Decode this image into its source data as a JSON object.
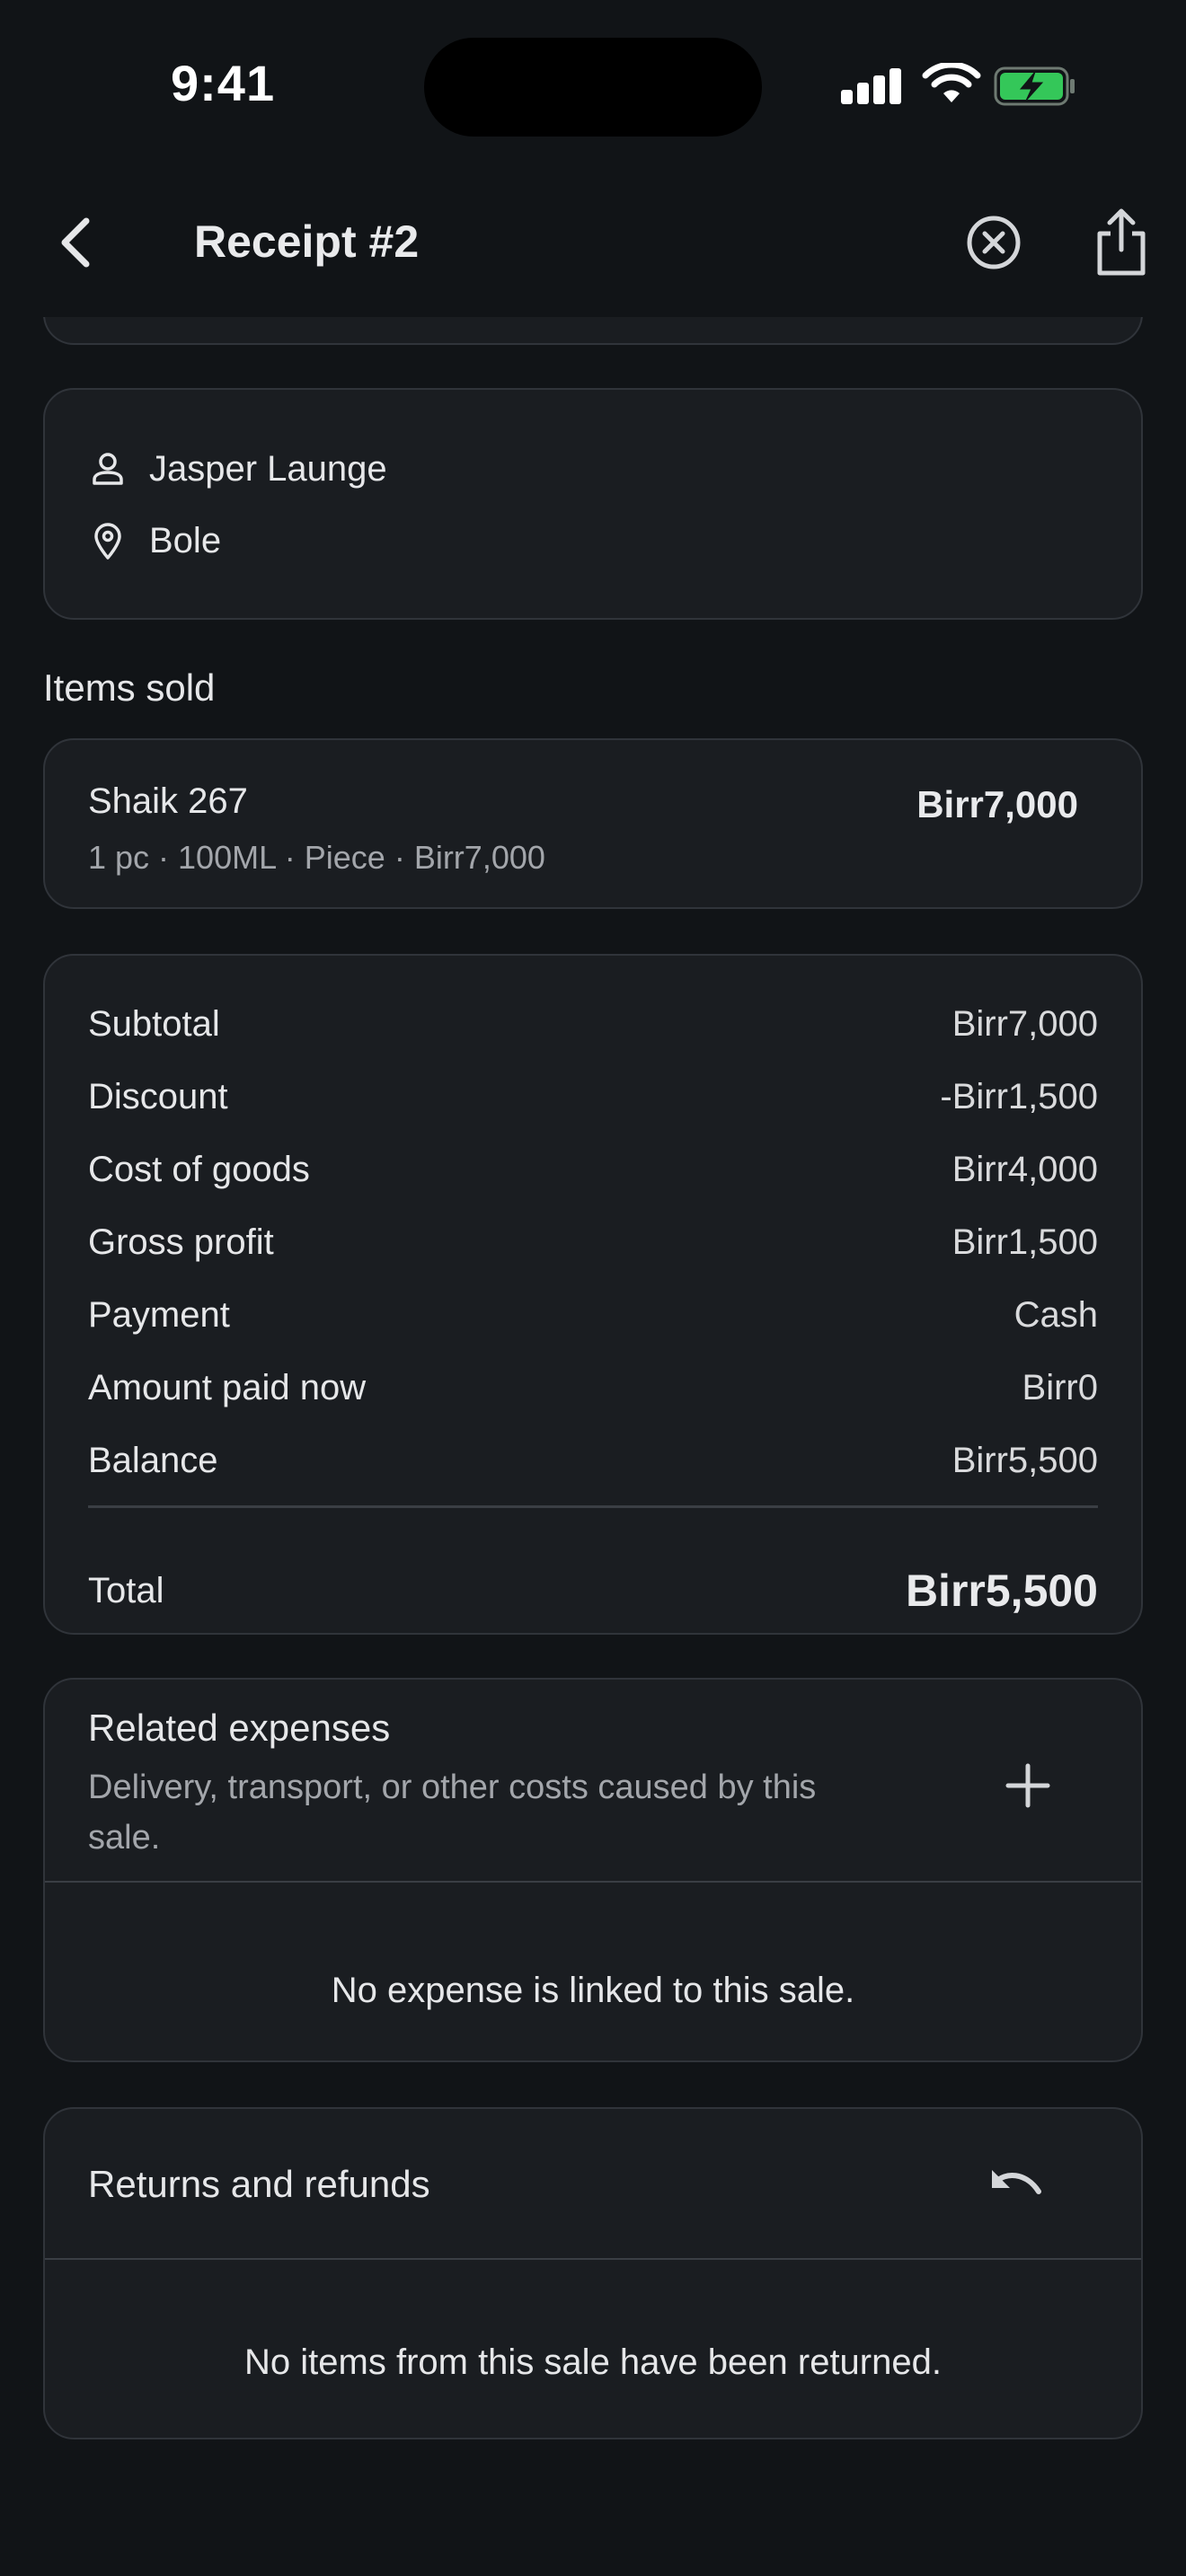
{
  "status": {
    "time": "9:41"
  },
  "header": {
    "title": "Receipt #2"
  },
  "customer": {
    "name": "Jasper Launge",
    "location": "Bole"
  },
  "items_section": {
    "label": "Items sold",
    "items": [
      {
        "name": "Shaik 267",
        "meta": "1 pc · 100ML · Piece · Birr7,000",
        "price": "Birr7,000"
      }
    ]
  },
  "summary": {
    "rows": [
      {
        "label": "Subtotal",
        "value": "Birr7,000"
      },
      {
        "label": "Discount",
        "value": "-Birr1,500"
      },
      {
        "label": "Cost of goods",
        "value": "Birr4,000"
      },
      {
        "label": "Gross profit",
        "value": "Birr1,500"
      },
      {
        "label": "Payment",
        "value": "Cash"
      },
      {
        "label": "Amount paid now",
        "value": "Birr0"
      },
      {
        "label": "Balance",
        "value": "Birr5,500"
      }
    ],
    "total_label": "Total",
    "total_value": "Birr5,500"
  },
  "expenses": {
    "title": "Related expenses",
    "subtitle": "Delivery, transport, or other costs caused by this sale.",
    "empty": "No expense is linked to this sale."
  },
  "returns": {
    "title": "Returns and refunds",
    "empty": "No items from this sale have been returned."
  },
  "colors": {
    "background": "#111417",
    "card": "#1a1d21",
    "border": "#30343a",
    "battery": "#34c759"
  },
  "icons": [
    "back-icon",
    "close-circle-icon",
    "share-icon",
    "person-icon",
    "location-pin-icon",
    "plus-icon",
    "undo-icon"
  ]
}
